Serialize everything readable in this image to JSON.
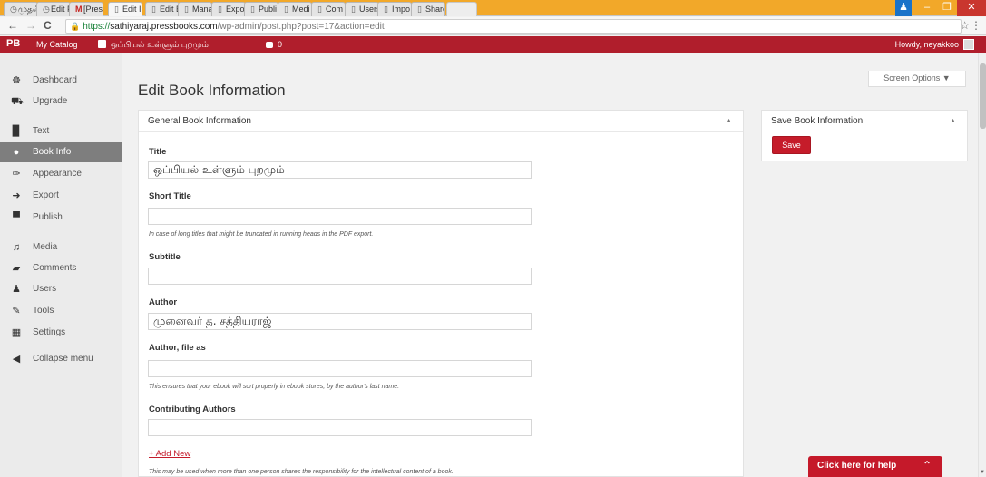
{
  "browser": {
    "tabs": [
      {
        "icon": "clock-icon",
        "glyph": "◷",
        "label": "முதல் ×"
      },
      {
        "icon": "clock-icon",
        "glyph": "◷",
        "label": "Edit F ×"
      },
      {
        "icon": "gmail-icon",
        "glyph": "M",
        "label": "[Press ×"
      },
      {
        "icon": "page-icon",
        "glyph": "▯",
        "label": "Edit I ×"
      },
      {
        "icon": "page-icon",
        "glyph": "▯",
        "label": "Edit E ×"
      },
      {
        "icon": "page-icon",
        "glyph": "▯",
        "label": "Mana ×"
      },
      {
        "icon": "page-icon",
        "glyph": "▯",
        "label": "Expo ×"
      },
      {
        "icon": "page-icon",
        "glyph": "▯",
        "label": "Publi ×"
      },
      {
        "icon": "page-icon",
        "glyph": "▯",
        "label": "Medi ×"
      },
      {
        "icon": "page-icon",
        "glyph": "▯",
        "label": "Com ×"
      },
      {
        "icon": "page-icon",
        "glyph": "▯",
        "label": "Users ×"
      },
      {
        "icon": "page-icon",
        "glyph": "▯",
        "label": "Impo ×"
      },
      {
        "icon": "page-icon",
        "glyph": "▯",
        "label": "Share ×"
      }
    ],
    "active_tab_index": 3,
    "url_scheme": "https://",
    "url_host": "sathiyaraj.pressbooks.com",
    "url_path": "/wp-admin/post.php?post=17&action=edit",
    "back_glyph": "←",
    "forward_glyph": "→",
    "reload_glyph": "C",
    "star_glyph": "☆",
    "menu_glyph": "⋮",
    "tab_strip_color": "#f2a829"
  },
  "adminbar": {
    "logo": "PB",
    "my_catalog": "My Catalog",
    "book_title": "ஒப்பியல் உள்ளும் புறமும்",
    "comments_count": "0",
    "howdy": "Howdy, neyakkoo",
    "color": "#b01e2c"
  },
  "sidebar": {
    "items": [
      {
        "label": "Dashboard",
        "icon": "dashboard-icon",
        "glyph": "☸"
      },
      {
        "label": "Upgrade",
        "icon": "cart-icon",
        "glyph": "⛟"
      },
      {
        "label": "Text",
        "icon": "book-icon",
        "glyph": "▉"
      },
      {
        "label": "Book Info",
        "icon": "info-icon",
        "glyph": "●"
      },
      {
        "label": "Appearance",
        "icon": "brush-icon",
        "glyph": "✑"
      },
      {
        "label": "Export",
        "icon": "export-icon",
        "glyph": "➜"
      },
      {
        "label": "Publish",
        "icon": "store-icon",
        "glyph": "▀"
      },
      {
        "label": "Media",
        "icon": "media-icon",
        "glyph": "♫"
      },
      {
        "label": "Comments",
        "icon": "comment-icon",
        "glyph": "▰"
      },
      {
        "label": "Users",
        "icon": "users-icon",
        "glyph": "♟"
      },
      {
        "label": "Tools",
        "icon": "wrench-icon",
        "glyph": "✎"
      },
      {
        "label": "Settings",
        "icon": "settings-icon",
        "glyph": "▦"
      },
      {
        "label": "Collapse menu",
        "icon": "collapse-icon",
        "glyph": "◀"
      }
    ],
    "active_index": 3
  },
  "main": {
    "page_title": "Edit Book Information",
    "screen_options": "Screen Options ▼",
    "general_box_title": "General Book Information",
    "toggle_glyph": "▲",
    "fields": {
      "title_label": "Title",
      "title_value": "ஒப்பியல் உள்ளும் புறமும்",
      "short_title_label": "Short Title",
      "short_title_value": "",
      "short_title_help": "In case of long titles that might be truncated in running heads in the PDF export.",
      "subtitle_label": "Subtitle",
      "subtitle_value": "",
      "author_label": "Author",
      "author_value": "முனைவர் த. சத்தியராஜ்",
      "author_file_as_label": "Author, file as",
      "author_file_as_value": "",
      "author_file_as_help": "This ensures that your ebook will sort properly in ebook stores, by the author's last name.",
      "contributing_label": "Contributing Authors",
      "contributing_value": "",
      "add_new": "+ Add New",
      "contributing_help": "This may be used when more than one person shares the responsibility for the intellectual content of a book."
    },
    "save_box_title": "Save Book Information",
    "save_label": "Save",
    "help_button": "Click here for help",
    "help_caret": "⌃"
  }
}
